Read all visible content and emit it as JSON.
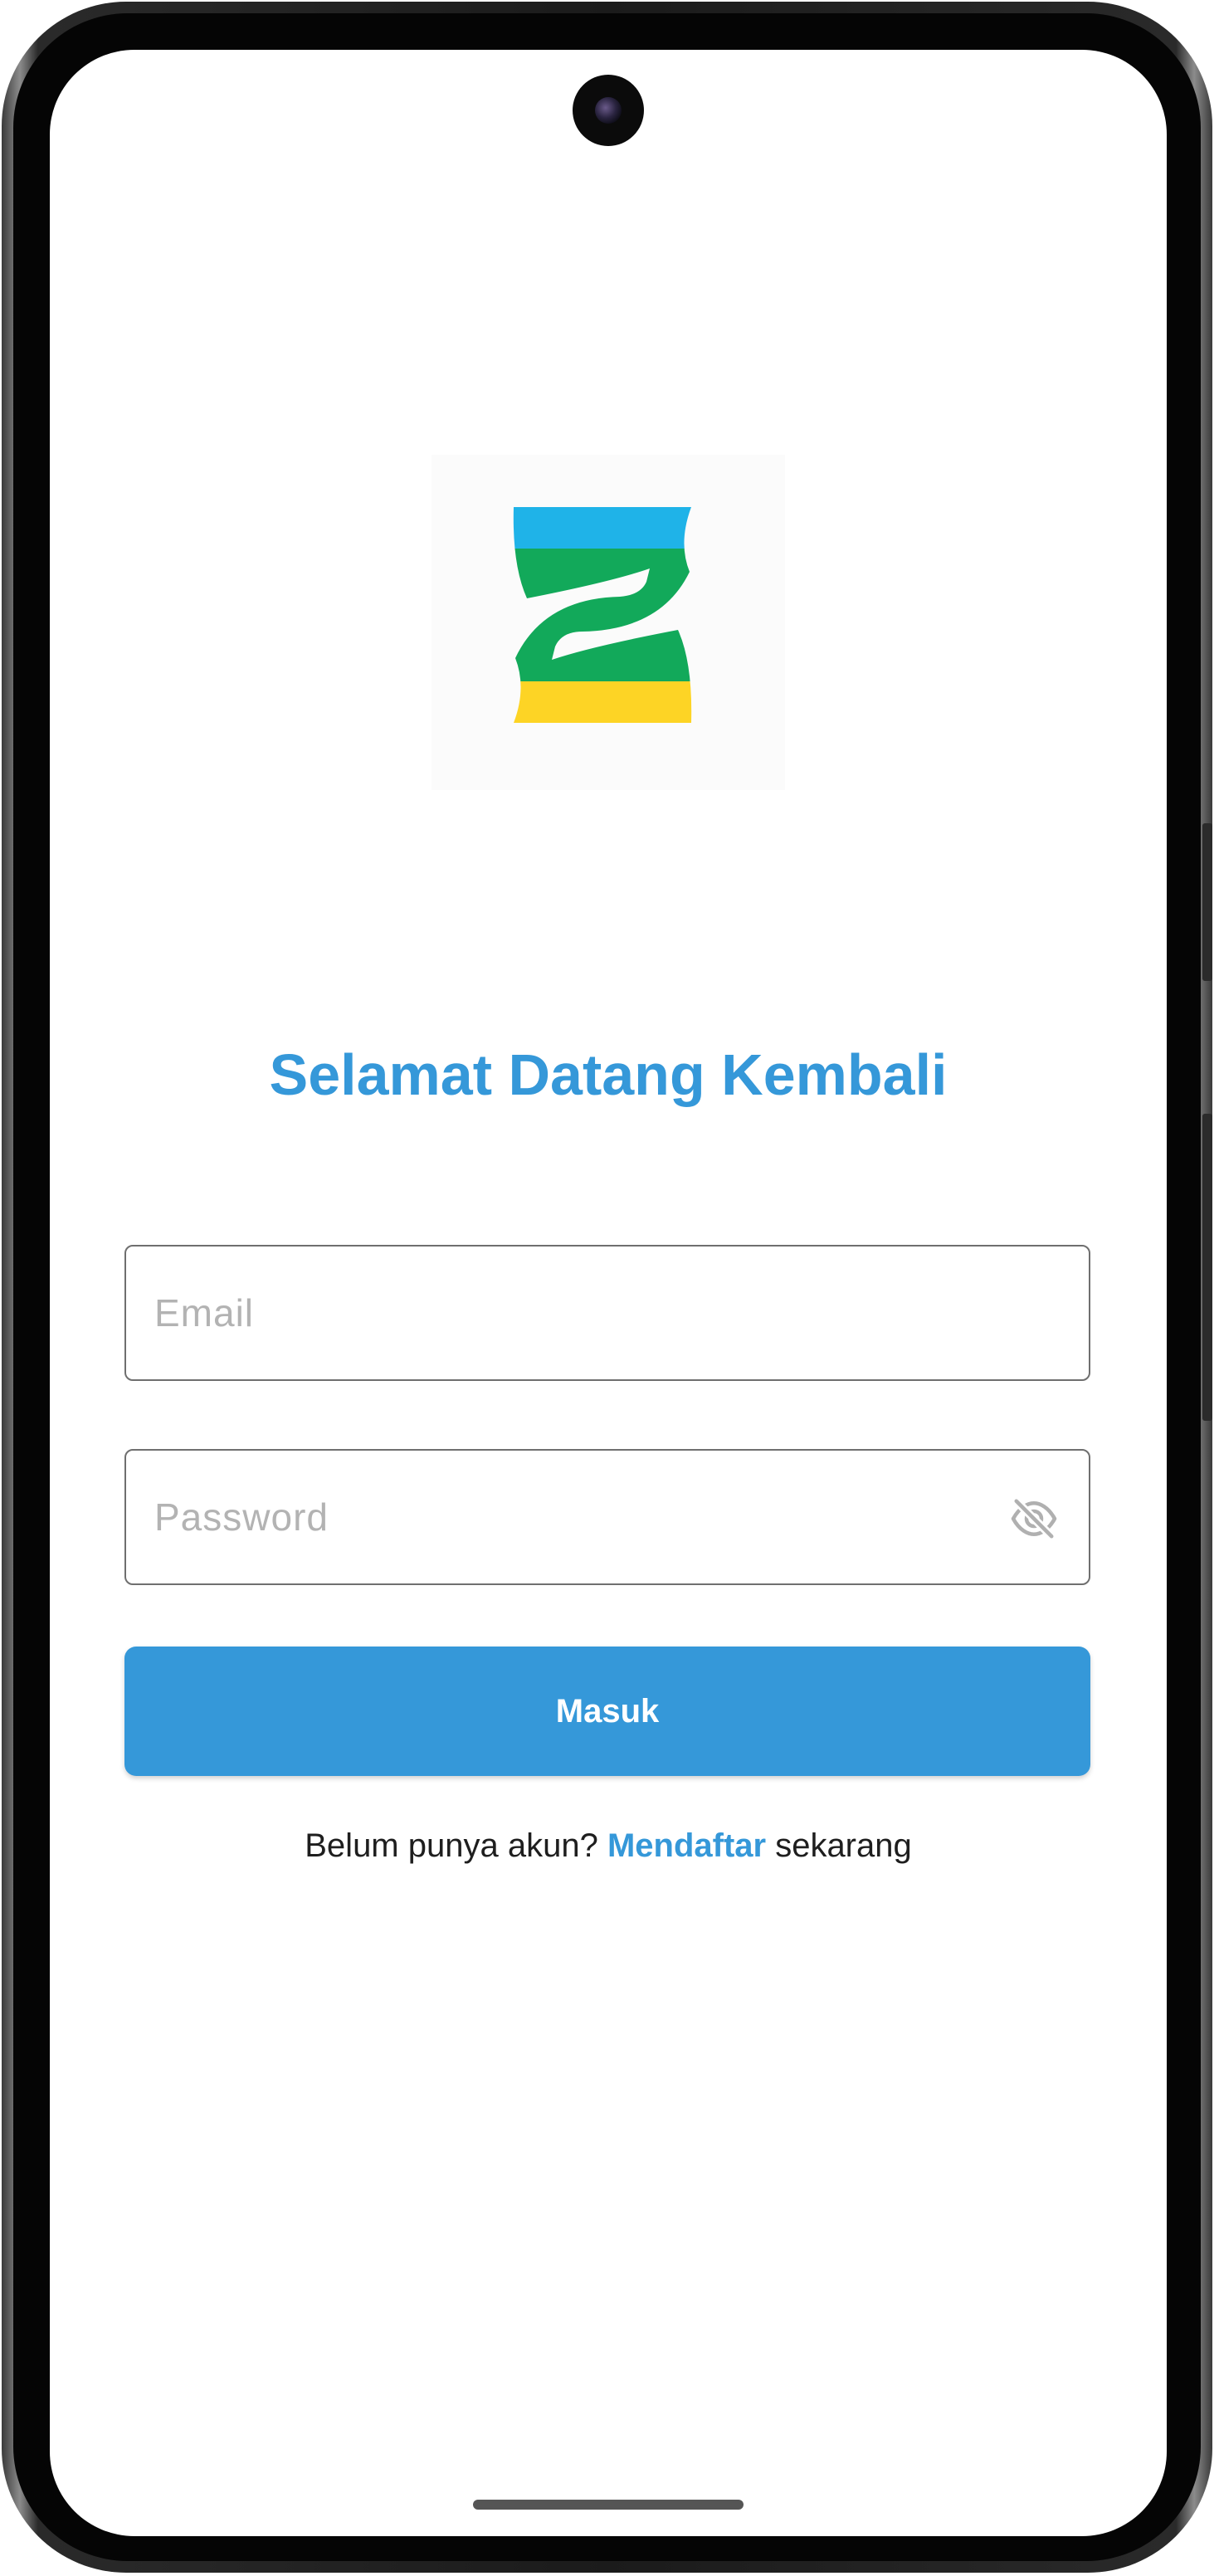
{
  "app": {
    "title": "Selamat Datang Kembali",
    "brand_color": "#3598d9",
    "logo_colors": [
      "#1fb3e8",
      "#12a95a",
      "#fdd425"
    ]
  },
  "form": {
    "email_placeholder": "Email",
    "email_value": "",
    "password_placeholder": "Password",
    "password_value": "",
    "password_toggle_icon": "eye-off-icon",
    "submit_label": "Masuk"
  },
  "footer": {
    "prompt": "Belum punya akun? ",
    "link_label": "Mendaftar",
    "suffix": " sekarang"
  }
}
